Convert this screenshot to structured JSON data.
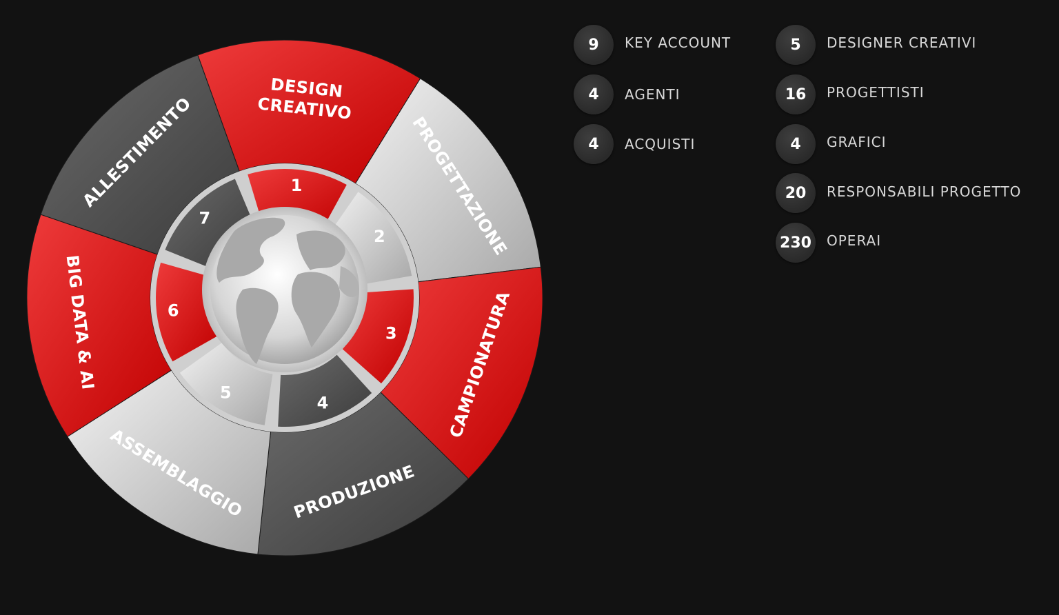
{
  "wheel": {
    "outer_segments": [
      {
        "id": "design",
        "lines": [
          "DESIGN",
          "CREATIVO"
        ],
        "style": "red"
      },
      {
        "id": "progettazione",
        "lines": [
          "PROGETTAZIONE"
        ],
        "style": "silver"
      },
      {
        "id": "campionatura",
        "lines": [
          "CAMPIONATURA"
        ],
        "style": "red"
      },
      {
        "id": "produzione",
        "lines": [
          "PRODUZIONE"
        ],
        "style": "dark"
      },
      {
        "id": "assemblaggio",
        "lines": [
          "ASSEMBLAGGIO"
        ],
        "style": "silver"
      },
      {
        "id": "bigdata",
        "lines": [
          "BIG DATA & AI"
        ],
        "style": "red"
      },
      {
        "id": "allestimento",
        "lines": [
          "ALLESTIMENTO"
        ],
        "style": "dark"
      }
    ],
    "inner_segments": [
      {
        "label": "1",
        "style": "red"
      },
      {
        "label": "2",
        "style": "silver"
      },
      {
        "label": "3",
        "style": "red"
      },
      {
        "label": "4",
        "style": "dark"
      },
      {
        "label": "5",
        "style": "silver"
      },
      {
        "label": "6",
        "style": "red"
      },
      {
        "label": "7",
        "style": "dark"
      }
    ],
    "center_icon": "globe-icon",
    "colors": {
      "red": "#d40000",
      "dark": "#4a4a4a",
      "silver": "#c8c8c8",
      "background": "#121212"
    }
  },
  "stats_left": [
    {
      "value": "9",
      "label": "KEY ACCOUNT"
    },
    {
      "value": "4",
      "label": "AGENTI"
    },
    {
      "value": "4",
      "label": "ACQUISTI"
    }
  ],
  "stats_right": [
    {
      "value": "5",
      "label": "DESIGNER CREATIVI"
    },
    {
      "value": "16",
      "label": "PROGETTISTI"
    },
    {
      "value": "4",
      "label": "GRAFICI"
    },
    {
      "value": "20",
      "label": "RESPONSABILI PROGETTO"
    },
    {
      "value": "230",
      "label": "OPERAI"
    }
  ]
}
